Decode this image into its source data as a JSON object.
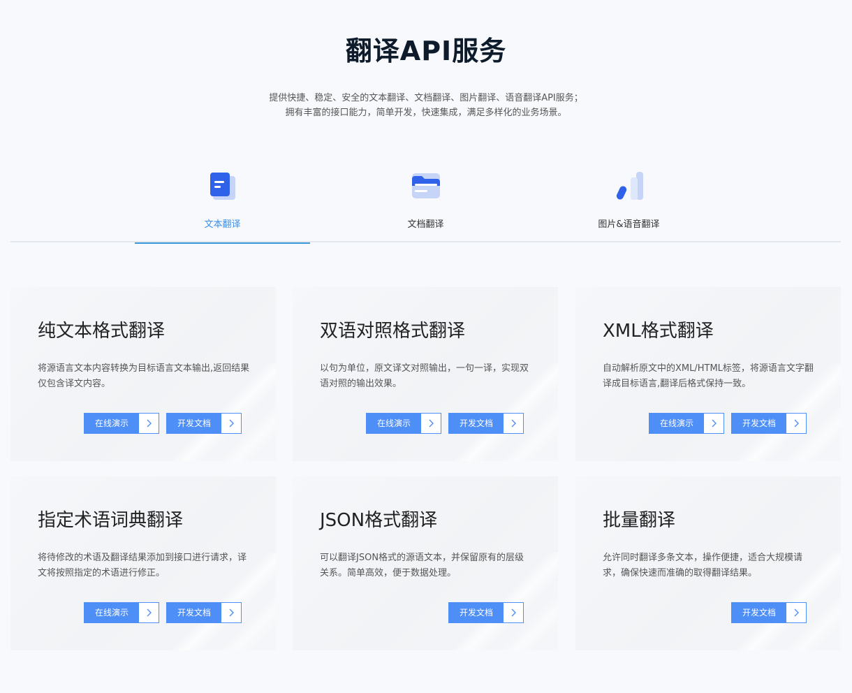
{
  "header": {
    "title": "翻译API服务",
    "subtitle_line1": "提供快捷、稳定、安全的文本翻译、文档翻译、图片翻译、语音翻译API服务；",
    "subtitle_line2": "拥有丰富的接口能力，简单开发，快速集成，满足多样化的业务场景。"
  },
  "tabs": [
    {
      "label": "文本翻译",
      "icon": "text-document-icon",
      "active": true
    },
    {
      "label": "文档翻译",
      "icon": "folder-icon",
      "active": false
    },
    {
      "label": "图片&语音翻译",
      "icon": "image-voice-icon",
      "active": false
    }
  ],
  "cards": [
    {
      "title": "纯文本格式翻译",
      "desc": "将源语言文本内容转换为目标语言文本输出,返回结果仅包含译文内容。",
      "demo_label": "在线演示",
      "docs_label": "开发文档"
    },
    {
      "title": "双语对照格式翻译",
      "desc": "以句为单位，原文译文对照输出，一句一译，实现双语对照的输出效果。",
      "demo_label": "在线演示",
      "docs_label": "开发文档"
    },
    {
      "title": "XML格式翻译",
      "desc": "自动解析原文中的XML/HTML标签，将源语言文字翻译成目标语言,翻译后格式保持一致。",
      "demo_label": "在线演示",
      "docs_label": "开发文档"
    },
    {
      "title": "指定术语词典翻译",
      "desc": "将待修改的术语及翻译结果添加到接口进行请求，译文将按照指定的术语进行修正。",
      "demo_label": "在线演示",
      "docs_label": "开发文档"
    },
    {
      "title": "JSON格式翻译",
      "desc": "可以翻译JSON格式的源语文本，并保留原有的层级关系。简单高效，便于数据处理。",
      "docs_label": "开发文档"
    },
    {
      "title": "批量翻译",
      "desc": "允许同时翻译多条文本，操作便捷，适合大规模请求，确保快速而准确的取得翻译结果。",
      "docs_label": "开发文档"
    }
  ],
  "colors": {
    "accent": "#4e8ef7",
    "tab_active": "#3a8ee6",
    "background": "#f7f9fc"
  }
}
